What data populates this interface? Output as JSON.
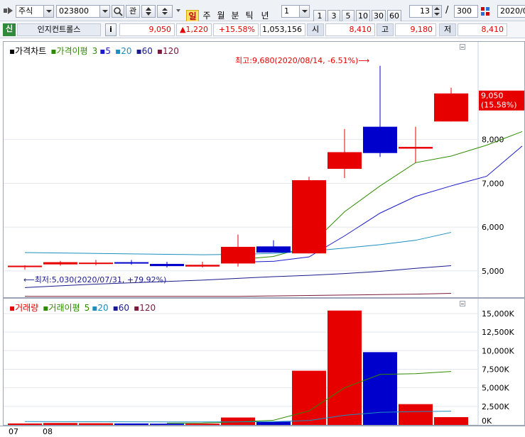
{
  "toolbar": {
    "market": "주식",
    "code": "023800",
    "analysis_label": "관",
    "periods": [
      "일",
      "주",
      "월",
      "분",
      "틱",
      "년"
    ],
    "active_period": "일",
    "interval_value": "1",
    "interval_buttons": [
      "1",
      "3",
      "5",
      "10",
      "30",
      "60"
    ],
    "count_value": "13",
    "slash": "/",
    "total_value": "300",
    "date_value": "2020/0"
  },
  "quote": {
    "badge": "신",
    "name": "인지컨트롤스",
    "info_label": "i",
    "price": "9,050",
    "change": "▲1,220",
    "change_pct": "+15.58%",
    "volume": "1,053,156",
    "open_label": "시",
    "open": "8,410",
    "high_label": "고",
    "high": "9,180",
    "low_label": "저",
    "low": "8,410"
  },
  "price_pane": {
    "legend": {
      "title": "가격차트",
      "ma_label": "가격이평",
      "ma_periods": [
        "3",
        "5",
        "20",
        "60",
        "120"
      ]
    },
    "y_ticks": [
      "8,000",
      "7,000",
      "6,000",
      "5,000"
    ],
    "current_price_label": "9,050",
    "current_pct_label": "(15.58%)",
    "high_annotation": "최고:9,680(2020/08/14, -6.51%)",
    "low_annotation": "최저:5,030(2020/07/31, +79.92%)"
  },
  "volume_pane": {
    "legend": {
      "title": "거래량",
      "ma_label": "거래이평",
      "ma_periods": [
        "5",
        "20",
        "60",
        "120"
      ]
    },
    "y_ticks": [
      "15,000K",
      "12,500K",
      "10,000K",
      "7,500K",
      "5,000K",
      "2,500K",
      "0K"
    ]
  },
  "x_labels": [
    "07",
    "08"
  ],
  "colors": {
    "up": "#e60000",
    "down": "#0000cc",
    "ma3": "#2e8b00",
    "ma5": "#1a1acc",
    "ma20": "#1b8fbf",
    "ma60": "#1a1a8c",
    "ma120": "#7a1a3a"
  },
  "chart_data": {
    "type": "candlestick",
    "ylim": [
      4400,
      10000
    ],
    "candles": [
      {
        "o": 5120,
        "h": 5130,
        "l": 5030,
        "c": 5120
      },
      {
        "o": 5150,
        "h": 5230,
        "l": 5120,
        "c": 5200
      },
      {
        "o": 5180,
        "h": 5250,
        "l": 5130,
        "c": 5190
      },
      {
        "o": 5200,
        "h": 5250,
        "l": 5140,
        "c": 5180
      },
      {
        "o": 5160,
        "h": 5210,
        "l": 5080,
        "c": 5110
      },
      {
        "o": 5100,
        "h": 5210,
        "l": 5080,
        "c": 5140
      },
      {
        "o": 5170,
        "h": 5830,
        "l": 5100,
        "c": 5550
      },
      {
        "o": 5560,
        "h": 5700,
        "l": 5430,
        "c": 5420
      },
      {
        "o": 5400,
        "h": 7150,
        "l": 5400,
        "c": 7070
      },
      {
        "o": 7330,
        "h": 8240,
        "l": 7120,
        "c": 7710
      },
      {
        "o": 8290,
        "h": 9680,
        "l": 7600,
        "c": 7690
      },
      {
        "o": 7790,
        "h": 8290,
        "l": 7470,
        "c": 7830
      },
      {
        "o": 8410,
        "h": 9180,
        "l": 8410,
        "c": 9050
      }
    ],
    "ma": [
      {
        "name": "3",
        "from": 6,
        "values": [
          5260,
          5330,
          5560,
          6350,
          6940,
          7470,
          7620,
          7870,
          8180
        ]
      },
      {
        "name": "5",
        "from": 6,
        "values": [
          5200,
          5220,
          5320,
          5800,
          6320,
          6700,
          6940,
          7160,
          7850
        ]
      },
      {
        "name": "20",
        "values": [
          5420,
          5410,
          5400,
          5390,
          5380,
          5370,
          5380,
          5400,
          5450,
          5520,
          5600,
          5700,
          5880
        ]
      },
      {
        "name": "60",
        "values": [
          4620,
          4660,
          4700,
          4730,
          4760,
          4790,
          4830,
          4870,
          4900,
          4940,
          4990,
          5060,
          5120
        ]
      },
      {
        "name": "120",
        "values": [
          4420,
          4420,
          4420,
          4420,
          4420,
          4420,
          4420,
          4430,
          4440,
          4450,
          4460,
          4470,
          4490
        ]
      }
    ],
    "volume": {
      "ylim": [
        0,
        17000
      ],
      "values": [
        200,
        260,
        230,
        200,
        170,
        180,
        1000,
        450,
        7300,
        15400,
        9800,
        2800,
        1050
      ],
      "ma": [
        {
          "name": "5",
          "from": 4,
          "values": [
            240,
            260,
            420,
            630,
            1880,
            5000,
            6800,
            6900,
            7200
          ]
        },
        {
          "name": "20",
          "values": [
            450,
            440,
            430,
            420,
            410,
            400,
            420,
            440,
            600,
            1300,
            1700,
            1800,
            1850
          ]
        }
      ]
    }
  }
}
